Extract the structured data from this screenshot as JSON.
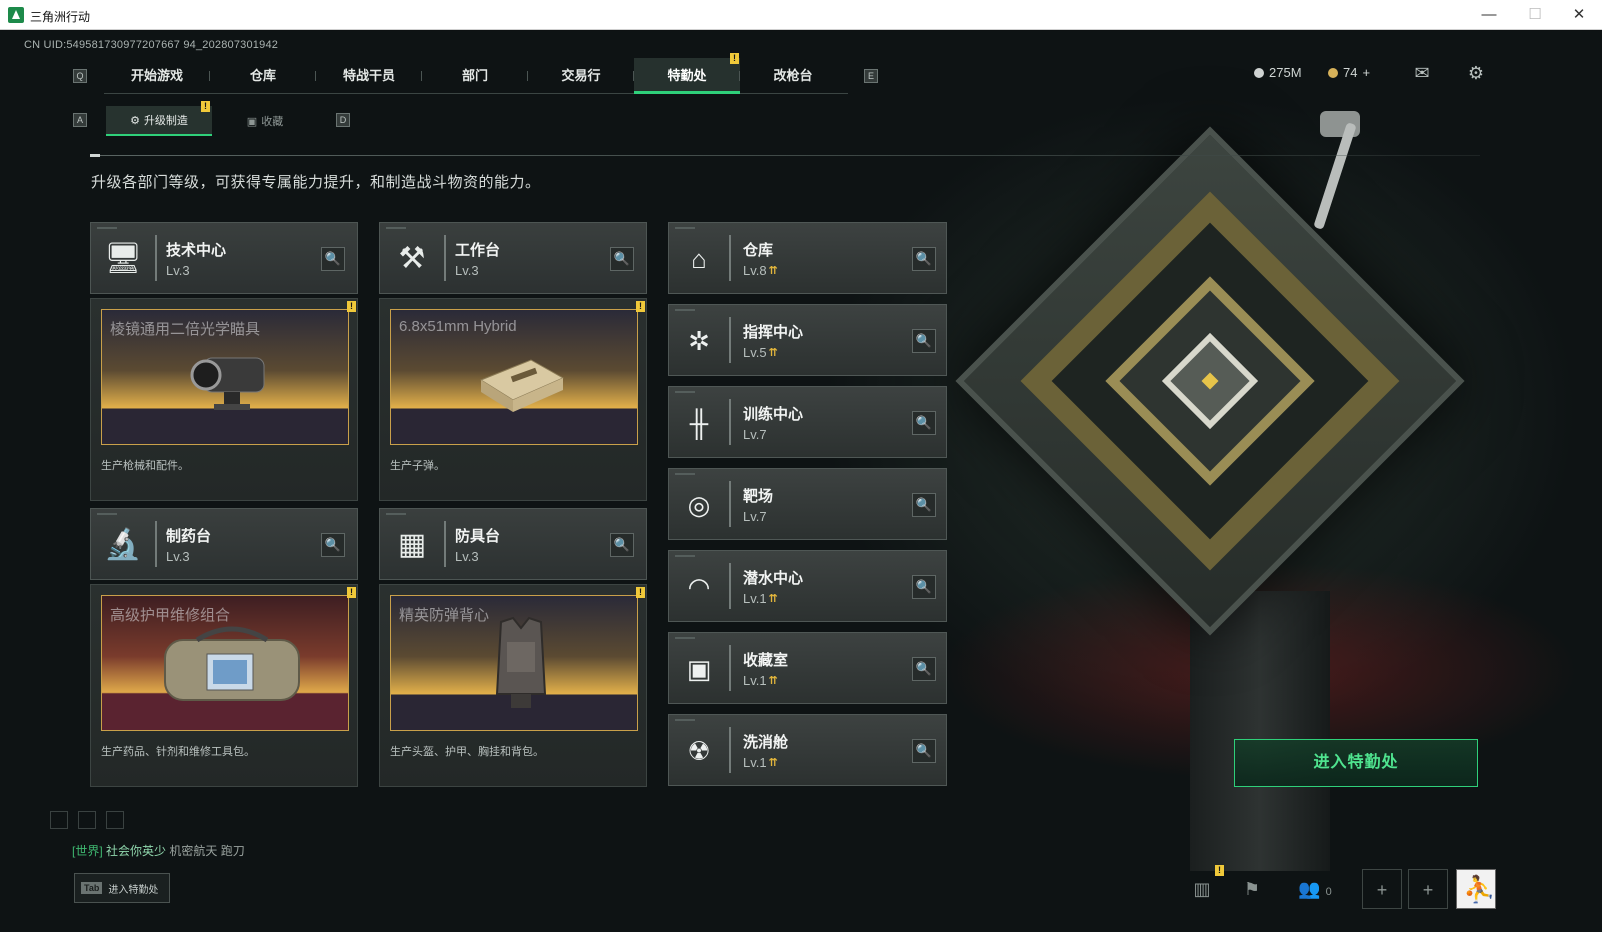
{
  "window": {
    "title": "三角洲行动",
    "minimize": "—",
    "maximize": "☐",
    "close": "✕"
  },
  "uid": "CN UID:549581730977207667 94_202807301942",
  "nav": {
    "key_left": "Q",
    "key_right": "E",
    "tabs": [
      "开始游戏",
      "仓库",
      "特战干员",
      "部门",
      "交易行",
      "特勤处",
      "改枪台"
    ],
    "active": "特勤处",
    "badge": "!"
  },
  "currency": {
    "coin1": "275M",
    "coin2": "74",
    "plus": "+"
  },
  "subnav": {
    "key_left": "A",
    "key_right": "D",
    "tabs": [
      "升级制造",
      "收藏"
    ],
    "active": "升级制造",
    "badge": "!"
  },
  "description": "升级各部门等级，可获得专属能力提升，和制造战斗物资的能力。",
  "workshops": [
    {
      "name": "技术中心",
      "level": "Lv.3",
      "icon": "computer-icon",
      "preview_title": "棱镜通用二倍光学瞄具",
      "caption": "生产枪械和配件。",
      "badge": "!"
    },
    {
      "name": "工作台",
      "level": "Lv.3",
      "icon": "tools-icon",
      "preview_title": "6.8x51mm Hybrid",
      "caption": "生产子弹。",
      "badge": "!"
    },
    {
      "name": "制药台",
      "level": "Lv.3",
      "icon": "microscope-icon",
      "preview_title": "高级护甲维修组合",
      "caption": "生产药品、针剂和维修工具包。",
      "badge": "!"
    },
    {
      "name": "防具台",
      "level": "Lv.3",
      "icon": "boxes-icon",
      "preview_title": "精英防弹背心",
      "caption": "生产头盔、护甲、胸挂和背包。",
      "badge": "!"
    }
  ],
  "facilities": [
    {
      "name": "仓库",
      "level": "Lv.8",
      "icon": "warehouse-icon",
      "upgradable": true
    },
    {
      "name": "指挥中心",
      "level": "Lv.5",
      "icon": "command-icon",
      "upgradable": true
    },
    {
      "name": "训练中心",
      "level": "Lv.7",
      "icon": "dumbbell-icon",
      "upgradable": false
    },
    {
      "name": "靶场",
      "level": "Lv.7",
      "icon": "target-icon",
      "upgradable": false
    },
    {
      "name": "潜水中心",
      "level": "Lv.1",
      "icon": "diving-mask-icon",
      "upgradable": true
    },
    {
      "name": "收藏室",
      "level": "Lv.1",
      "icon": "collection-icon",
      "upgradable": true
    },
    {
      "name": "洗消舱",
      "level": "Lv.1",
      "icon": "decon-icon",
      "upgradable": true
    }
  ],
  "enter_button": "进入特勤处",
  "chat": {
    "channel": "[世界]",
    "user": "社会你英少",
    "message": "机密航天 跑刀"
  },
  "tab_hint": {
    "key": "Tab",
    "label": "进入特勤处"
  },
  "friends_count": "0",
  "colors": {
    "accent": "#2fd07a",
    "badge": "#f0c93a",
    "upgrade_arrow": "#e3b63c"
  }
}
